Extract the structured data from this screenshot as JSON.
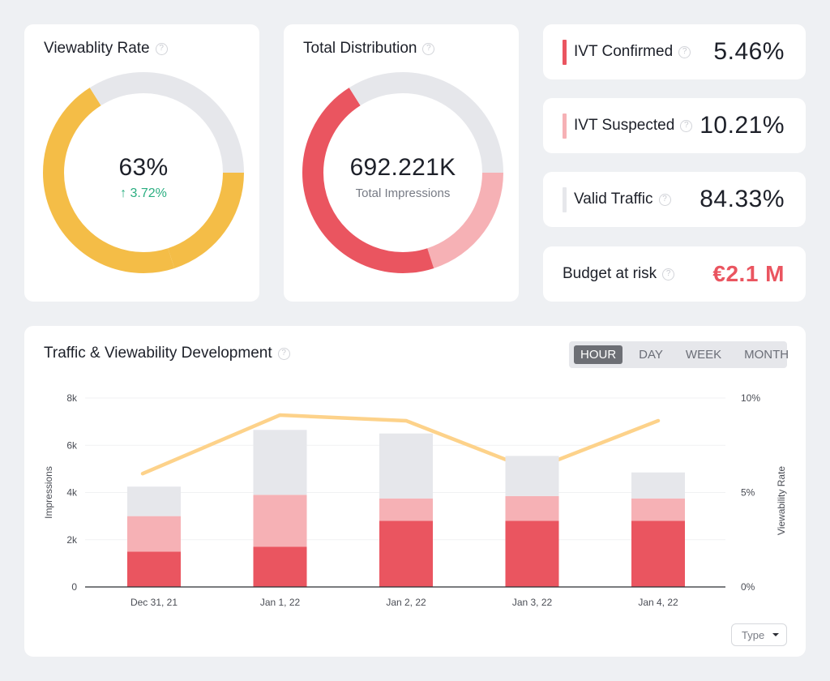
{
  "viewability": {
    "title": "Viewablity Rate",
    "value": "63%",
    "delta": "3.72%",
    "delta_direction": "up",
    "segments": [
      {
        "name": "viewable-part-1",
        "fraction": 0.2,
        "color": "#f4bd47"
      },
      {
        "name": "viewable-part-2",
        "fraction": 0.46,
        "color": "#f4bd47"
      },
      {
        "name": "remaining",
        "fraction": 0.34,
        "color": "#e6e7eb"
      }
    ]
  },
  "distribution": {
    "title": "Total Distribution",
    "value": "692.221K",
    "label": "Total Impressions",
    "segments": [
      {
        "name": "ivt-suspected",
        "fraction": 0.2,
        "color": "#f6b1b5"
      },
      {
        "name": "ivt-confirmed",
        "fraction": 0.46,
        "color": "#ea5560"
      },
      {
        "name": "valid",
        "fraction": 0.34,
        "color": "#e6e7eb"
      }
    ]
  },
  "stats": [
    {
      "label": "IVT Confirmed",
      "value": "5.46%",
      "color": "#ea5560"
    },
    {
      "label": "IVT Suspected",
      "value": "10.21%",
      "color": "#f6b1b5"
    },
    {
      "label": "Valid Traffic",
      "value": "84.33%",
      "color": "#e6e7eb"
    },
    {
      "label": "Budget at risk",
      "value": "€2.1 M",
      "color": "#ea5560"
    }
  ],
  "development": {
    "title": "Traffic & Viewability Development",
    "tabs": [
      {
        "label": "HOUR",
        "active": true
      },
      {
        "label": "DAY",
        "active": false
      },
      {
        "label": "WEEK",
        "active": false
      },
      {
        "label": "MONTH",
        "active": false
      }
    ],
    "type_select": "Type"
  },
  "help_glyph": "?",
  "up_arrow_glyph": "↑",
  "chart_data": {
    "type": "bar",
    "title": "Traffic & Viewability Development",
    "categories": [
      "Dec 31, 21",
      "Jan 1, 22",
      "Jan 2, 22",
      "Jan 3, 22",
      "Jan 4, 22"
    ],
    "ylabel": "Impressions",
    "ylabel_right": "Viewability Rate",
    "ylim": [
      0,
      8000
    ],
    "ylim_right": [
      0,
      10
    ],
    "yticks": [
      {
        "v": 0,
        "label": "0"
      },
      {
        "v": 2000,
        "label": "2k"
      },
      {
        "v": 4000,
        "label": "4k"
      },
      {
        "v": 6000,
        "label": "6k"
      },
      {
        "v": 8000,
        "label": "8k"
      }
    ],
    "yticks_right": [
      {
        "v": 0,
        "label": "0%"
      },
      {
        "v": 5,
        "label": "5%"
      },
      {
        "v": 10,
        "label": "10%"
      }
    ],
    "grid": true,
    "stacked": true,
    "series": [
      {
        "name": "IVT Confirmed",
        "color": "#ea5560",
        "values": [
          1500,
          1700,
          2800,
          2800,
          2800
        ]
      },
      {
        "name": "IVT Suspected",
        "color": "#f6b1b5",
        "values": [
          1500,
          2200,
          950,
          1050,
          950
        ]
      },
      {
        "name": "Valid Traffic",
        "color": "#e6e7eb",
        "values": [
          1250,
          2750,
          2750,
          1700,
          1100
        ]
      }
    ],
    "line_series": {
      "name": "Viewability Rate",
      "color": "#fdd28a",
      "axis": "right",
      "values": [
        6.0,
        9.1,
        8.8,
        6.2,
        8.8
      ]
    }
  }
}
